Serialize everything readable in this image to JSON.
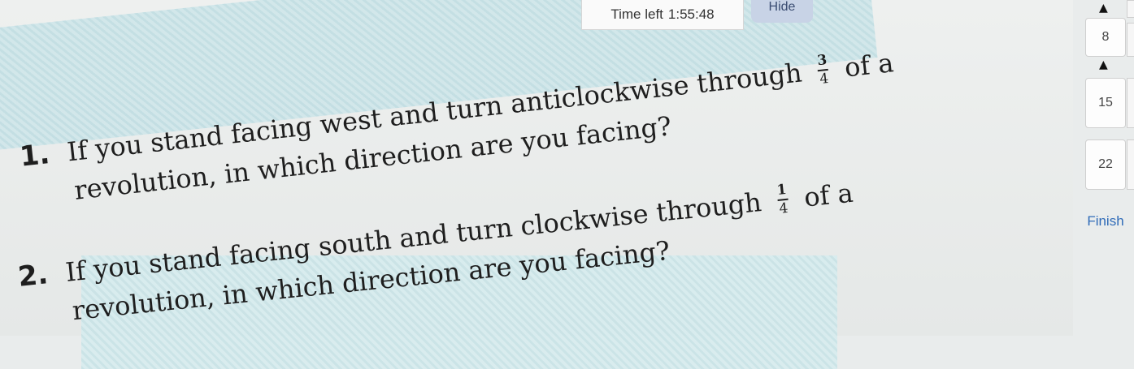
{
  "header": {
    "timer_label": "Time left",
    "timer_value": "1:55:48",
    "hide_label": "Hide"
  },
  "questions": [
    {
      "number": "1.",
      "line1_before": "If you stand facing west and turn anticlockwise through",
      "fraction": {
        "numerator": "3",
        "denominator": "4"
      },
      "line1_after": "of a",
      "line2": "revolution, in which direction are you facing?"
    },
    {
      "number": "2.",
      "line1_before": "If you stand facing south and turn clockwise through",
      "fraction": {
        "numerator": "1",
        "denominator": "4"
      },
      "line1_after": "of a",
      "line2": "revolution, in which direction are you facing?"
    }
  ],
  "nav": {
    "items": [
      "8",
      "15",
      "22"
    ],
    "finish_label": "Finish"
  },
  "colors": {
    "accent": "#2f6bb8",
    "hide_button": "#c8d3e6",
    "stripe": "#bfdde2"
  }
}
